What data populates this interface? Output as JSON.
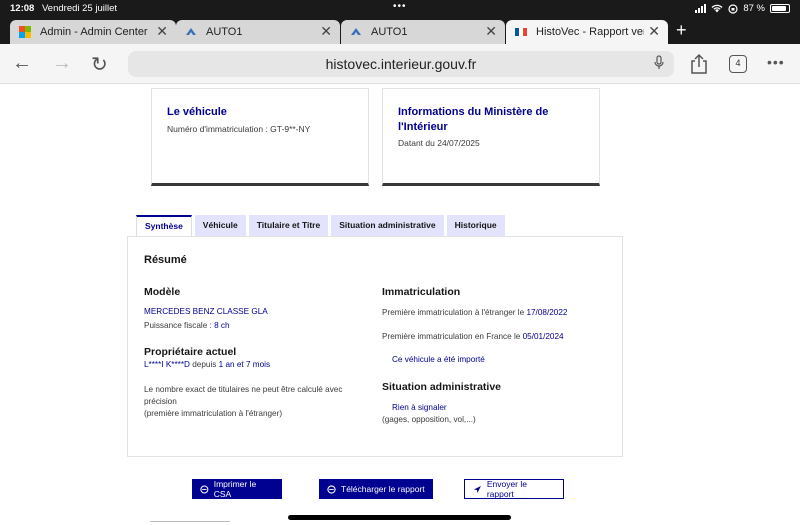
{
  "status": {
    "time": "12:08",
    "date": "Vendredi 25 juillet",
    "battery": "87 %"
  },
  "browser": {
    "tabs": [
      {
        "label": "Admin - Admin Center",
        "icon": "microsoft-icon",
        "active": false
      },
      {
        "label": "AUTO1",
        "icon": "auto1-icon",
        "active": false
      },
      {
        "label": "AUTO1",
        "icon": "auto1-icon",
        "active": false
      },
      {
        "label": "HistoVec - Rapport vendeur",
        "icon": "french-flag-icon",
        "active": true
      }
    ],
    "url": "histovec.interieur.gouv.fr",
    "tab_count": "4"
  },
  "cards": {
    "vehicle": {
      "title": "Le véhicule",
      "line": "Numéro d'immatriculation : GT-9**-NY"
    },
    "ministry": {
      "title_line1": "Informations du Ministère de",
      "title_line2": "l'Intérieur",
      "line": "Datant du 24/07/2025"
    }
  },
  "page_tabs": [
    "Synthèse",
    "Véhicule",
    "Titulaire et Titre",
    "Situation administrative",
    "Historique"
  ],
  "summary": {
    "title": "Résumé",
    "model": {
      "heading": "Modèle",
      "name": "MERCEDES BENZ CLASSE GLA",
      "fiscal_label": "Puissance fiscale : ",
      "fiscal_value": "8 ch"
    },
    "owner": {
      "heading": "Propriétaire actuel",
      "name": "L****I K****D",
      "since_label": " depuis ",
      "since_value": "1 an et 7 mois",
      "note_line1": "Le nombre exact de titulaires ne peut être calculé avec",
      "note_line2": "précision",
      "note_line3": "(première immatriculation à l'étranger)"
    },
    "registration": {
      "heading": "Immatriculation",
      "abroad_label": "Première immatriculation à l'étranger le ",
      "abroad_date": "17/08/2022",
      "france_label": "Première immatriculation en France le ",
      "france_date": "05/01/2024",
      "imported": "Ce véhicule a été importé"
    },
    "admin": {
      "heading": "Situation administrative",
      "status": "Rien à signaler",
      "detail": "(gages, opposition, vol,...)"
    }
  },
  "actions": {
    "print": "Imprimer le CSA",
    "download": "Télécharger le rapport",
    "send": "Envoyer le rapport"
  },
  "colors": {
    "primary": "#000091",
    "tab_bg": "#e3e3fd"
  }
}
